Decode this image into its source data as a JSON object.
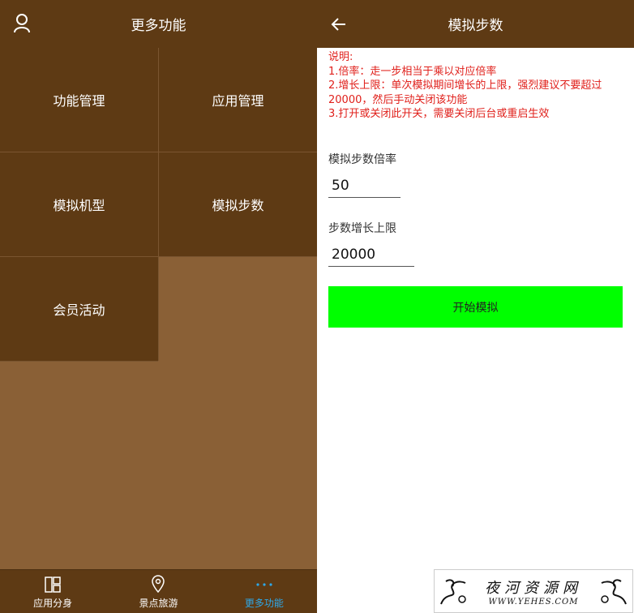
{
  "left": {
    "header": {
      "title": "更多功能",
      "left_icon": "user-icon"
    },
    "grid": [
      {
        "label": "功能管理"
      },
      {
        "label": "应用管理"
      },
      {
        "label": "模拟机型"
      },
      {
        "label": "模拟步数"
      },
      {
        "label": "会员活动"
      }
    ],
    "tabbar": [
      {
        "label": "应用分身",
        "icon": "layout-icon",
        "active": false
      },
      {
        "label": "景点旅游",
        "icon": "location-pin-icon",
        "active": false
      },
      {
        "label": "更多功能",
        "icon": "more-dots-icon",
        "active": true
      }
    ]
  },
  "right": {
    "header": {
      "title": "模拟步数",
      "left_icon": "back-arrow-icon"
    },
    "notes": [
      "说明:",
      "1.倍率：走一步相当于乘以对应倍率",
      "2.增长上限：单次模拟期间增长的上限，强烈建议不要超过20000，然后手动关闭该功能",
      "3.打开或关闭此开关，需要关闭后台或重启生效"
    ],
    "multiplier": {
      "label": "模拟步数倍率",
      "value": "50"
    },
    "limit": {
      "label": "步数增长上限",
      "value": "20000"
    },
    "start_button": "开始模拟"
  },
  "watermark": {
    "title": "夜河资源网",
    "url": "WWW.YEHES.COM"
  },
  "colors": {
    "header_bg": "#5e3a14",
    "body_bg": "#8a6036",
    "active_tab": "#2ea8e8",
    "note_text": "#e0201b",
    "start_button_bg": "#00ff00"
  }
}
